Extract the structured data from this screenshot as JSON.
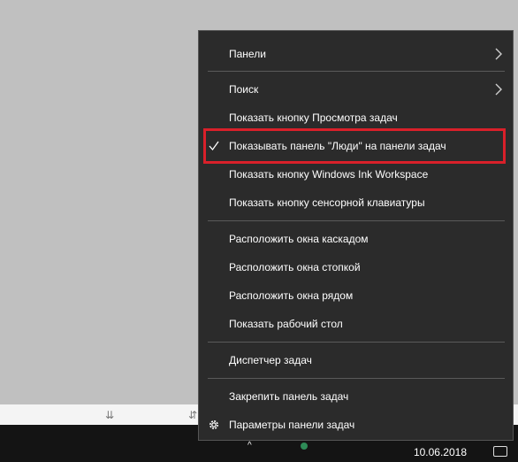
{
  "menu": {
    "items": [
      {
        "label": "Панели"
      },
      {
        "label": "Поиск"
      },
      {
        "label": "Показать кнопку Просмотра задач"
      },
      {
        "label": "Показывать панель \"Люди\" на панели задач"
      },
      {
        "label": "Показать кнопку Windows Ink Workspace"
      },
      {
        "label": "Показать кнопку сенсорной клавиатуры"
      },
      {
        "label": "Расположить окна каскадом"
      },
      {
        "label": "Расположить окна стопкой"
      },
      {
        "label": "Расположить окна рядом"
      },
      {
        "label": "Показать рабочий стол"
      },
      {
        "label": "Диспетчер задач"
      },
      {
        "label": "Закрепить панель задач"
      },
      {
        "label": "Параметры панели задач"
      }
    ]
  },
  "taskbar": {
    "date": "10.06.2018"
  },
  "colors": {
    "menu_bg": "#2b2b2b",
    "highlight": "#d9202a",
    "taskbar_bg": "#141414"
  }
}
